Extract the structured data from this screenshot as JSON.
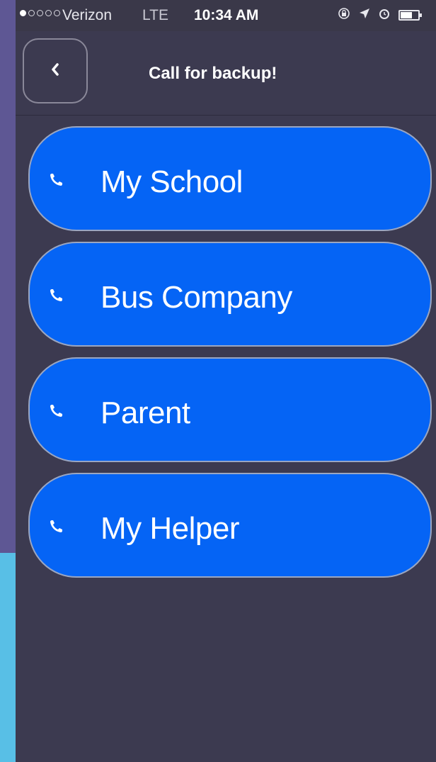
{
  "status_bar": {
    "signal_dots_filled": 1,
    "signal_dots_total": 5,
    "carrier": "Verizon",
    "network": "LTE",
    "time": "10:34 AM",
    "icons": [
      "orientation-lock-icon",
      "location-arrow-icon",
      "alarm-icon",
      "battery-icon"
    ]
  },
  "nav": {
    "back_icon": "chevron-left-icon",
    "title": "Call for backup!"
  },
  "calls": [
    {
      "label": "My School",
      "icon": "phone-icon"
    },
    {
      "label": "Bus Company",
      "icon": "phone-icon"
    },
    {
      "label": "Parent",
      "icon": "phone-icon"
    },
    {
      "label": "My Helper",
      "icon": "phone-icon"
    }
  ],
  "colors": {
    "background": "#3c3a50",
    "button": "#0564f5",
    "side_strip_top": "#5e5794",
    "side_strip_bottom": "#58bfe6"
  }
}
